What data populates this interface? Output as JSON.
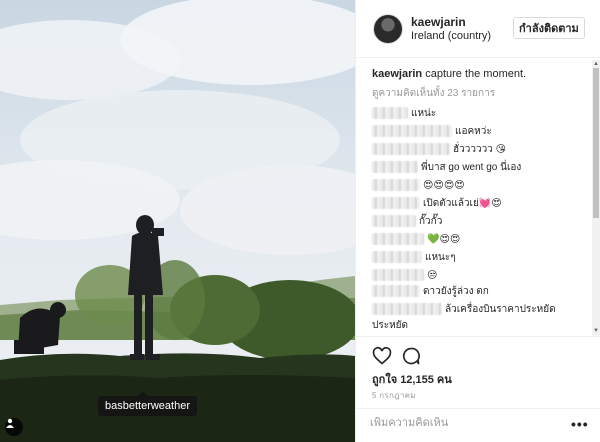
{
  "photo": {
    "tag_label": "basbetterweather",
    "person_tag_icon": "person-icon"
  },
  "header": {
    "username": "kaewjarin",
    "location": "Ireland (country)",
    "follow_label": "กำลังติดตาม"
  },
  "caption": {
    "username": "kaewjarin",
    "text": "capture the moment."
  },
  "view_all_comments": "ดูความคิดเห็นทั้ง 23 รายการ",
  "comments": [
    {
      "text": "แหน่ะ"
    },
    {
      "text": "แอคหว่ะ"
    },
    {
      "text": "ฮั่วววววว 😘"
    },
    {
      "text": "พี่บาส go went go นี่เอง"
    },
    {
      "text": "😍😍😍😍"
    },
    {
      "text": "เปิดตัวแล้วเย่💓😍"
    },
    {
      "text": "กั๊วกั๊ว"
    },
    {
      "text": "💚😍😍"
    },
    {
      "text": "แหนะๆ"
    },
    {
      "text": "😒"
    },
    {
      "text": "ดาวยังรู้ล่วง ตก"
    },
    {
      "text": "ล้วเครื่องบินราคาประหยัด"
    },
    {
      "text": "ประหยัด"
    }
  ],
  "actions": {
    "like_icon": "heart-icon",
    "comment_icon": "comment-icon",
    "likes_text": "ถูกใจ 12,155 คน",
    "date": "5 กรกฎาคม"
  },
  "add_comment": {
    "placeholder": "เพิ่มความคิดเห็น",
    "more_label": "•••"
  }
}
